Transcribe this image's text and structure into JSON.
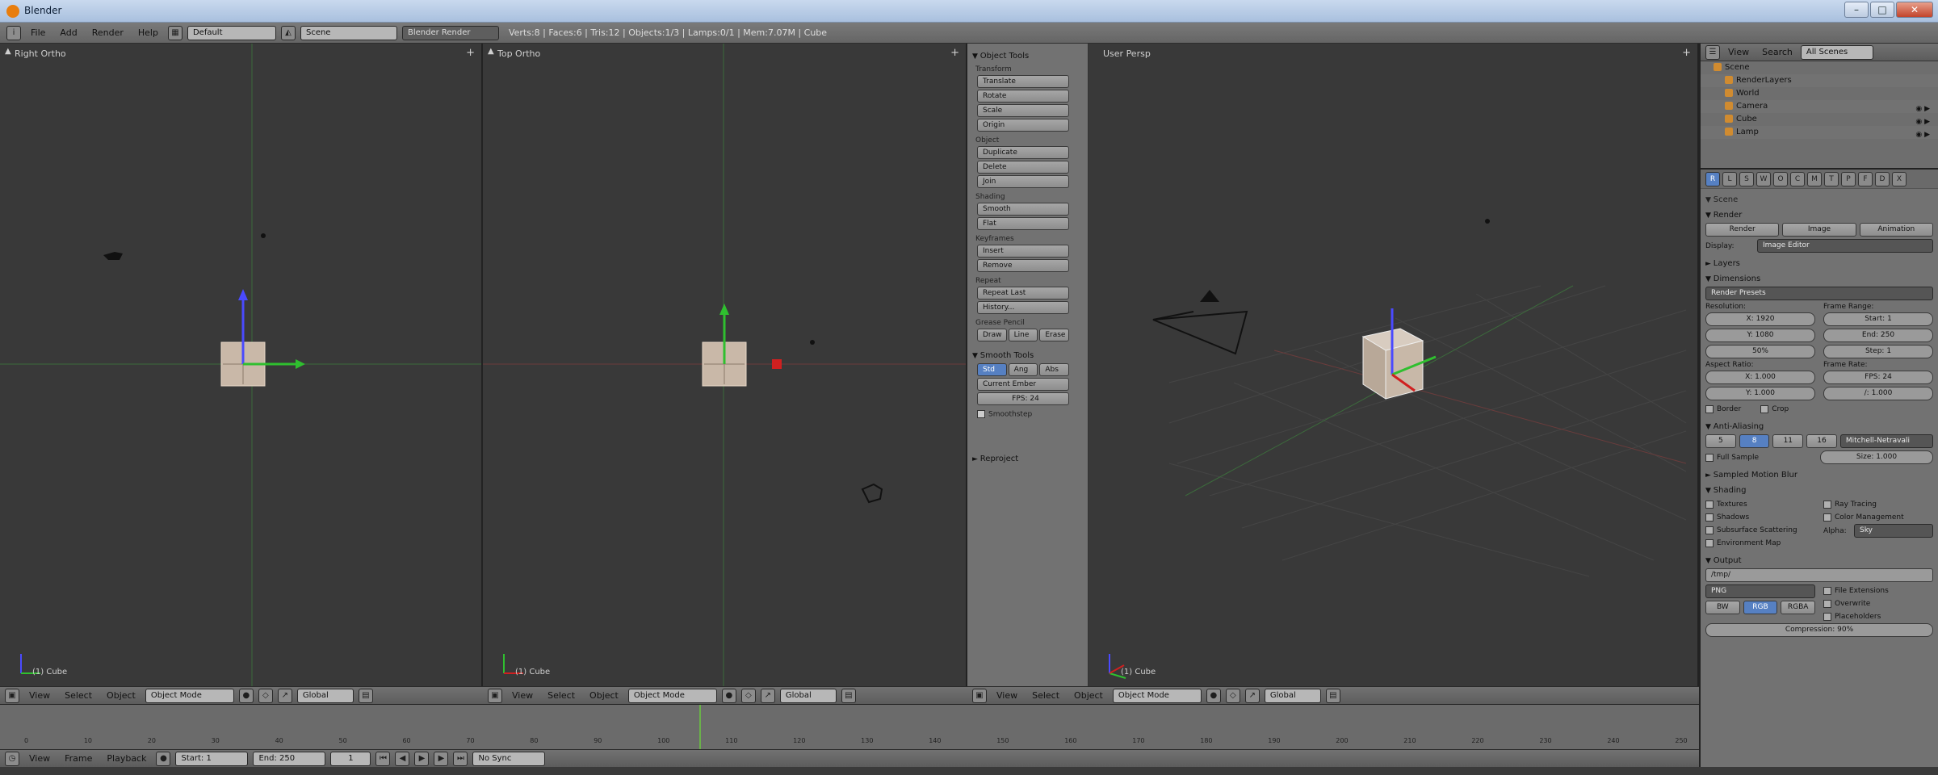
{
  "window": {
    "title": "Blender",
    "min": "–",
    "max": "□",
    "close": "✕"
  },
  "info": {
    "menus": [
      "File",
      "Add",
      "Render",
      "Help"
    ],
    "layout": "Default",
    "scene": "Scene",
    "engine": "Blender Render",
    "stats": "Verts:8 | Faces:6 | Tris:12 | Objects:1/3 | Lamps:0/1 | Mem:7.07M | Cube"
  },
  "viewports": {
    "left": {
      "title": "Right Ortho",
      "footer": "(1) Cube"
    },
    "middle": {
      "title": "Top Ortho",
      "footer": "(1) Cube"
    },
    "right": {
      "title": "User Persp",
      "footer": "(1) Cube"
    }
  },
  "toolshelf": {
    "title": "Object Tools",
    "groups": [
      {
        "label": "Transform",
        "buttons": [
          "Translate",
          "Rotate",
          "Scale",
          "Origin"
        ]
      },
      {
        "label": "Object",
        "buttons": [
          "Duplicate",
          "Delete",
          "Join"
        ]
      },
      {
        "label": "Shading",
        "buttons": [
          "Smooth",
          "Flat"
        ]
      },
      {
        "label": "Keyframes",
        "buttons": [
          "Insert",
          "Remove"
        ]
      },
      {
        "label": "Repeat",
        "buttons": [
          "Repeat Last",
          "History..."
        ]
      }
    ],
    "grease": {
      "label": "Grease Pencil",
      "buttons": [
        "Draw",
        "Line",
        "Erase"
      ]
    },
    "snap": {
      "title": "Smooth Tools",
      "buttons": [
        "Std",
        "Ang",
        "Abs"
      ],
      "field1": "Current Ember",
      "field2": "FPS: 24"
    },
    "smooth_check": "Smoothstep",
    "reproject": "Reproject"
  },
  "vp_header": {
    "menus": [
      "View",
      "Select",
      "Object"
    ],
    "mode": "Object Mode",
    "pivot": "Global"
  },
  "timeline": {
    "menus": [
      "View",
      "Frame",
      "Playback"
    ],
    "start": "Start: 1",
    "end": "End: 250",
    "current": "1",
    "keying": "No Sync",
    "ticks": [
      "0",
      "10",
      "20",
      "30",
      "40",
      "50",
      "60",
      "70",
      "80",
      "90",
      "100",
      "110",
      "120",
      "130",
      "140",
      "150",
      "160",
      "170",
      "180",
      "190",
      "200",
      "210",
      "220",
      "230",
      "240",
      "250"
    ]
  },
  "outliner": {
    "menus": [
      "View",
      "Search"
    ],
    "scene_sel": "All Scenes",
    "rows": [
      "Scene",
      "RenderLayers",
      "World",
      "Camera",
      "Cube",
      "Lamp"
    ]
  },
  "props": {
    "tabs": [
      "R",
      "L",
      "S",
      "W",
      "O",
      "C",
      "M",
      "T",
      "P",
      "F",
      "D",
      "X"
    ],
    "breadcrumb": "Scene",
    "render_title": "Render",
    "render_btns": [
      "Render",
      "Image",
      "Animation"
    ],
    "display_label": "Display:",
    "display_val": "Image Editor",
    "layers_title": "Layers",
    "dimensions_title": "Dimensions",
    "preset": "Render Presets",
    "res_h": "Resolution:",
    "res_x": "X: 1920",
    "res_y": "Y: 1080",
    "res_pct": "50%",
    "frame_h": "Frame Range:",
    "frame_start": "Start: 1",
    "frame_end": "End: 250",
    "frame_step": "Step: 1",
    "aspect_h": "Aspect Ratio:",
    "aspect_x": "X: 1.000",
    "aspect_y": "Y: 1.000",
    "fps_h": "Frame Rate:",
    "fps": "FPS: 24",
    "fps_base": "/: 1.000",
    "border": "Border",
    "crop": "Crop",
    "aa_title": "Anti-Aliasing",
    "aa_vals": [
      "5",
      "8",
      "11",
      "16"
    ],
    "aa_filter": "Mitchell-Netravali",
    "full_sample": "Full Sample",
    "aa_size": "Size: 1.000",
    "motion_title": "Sampled Motion Blur",
    "shading_title": "Shading",
    "shading_checks": [
      "Textures",
      "Shadows",
      "Subsurface Scattering",
      "Environment Map",
      "Ray Tracing",
      "Color Management"
    ],
    "alpha_label": "Alpha:",
    "alpha_val": "Sky",
    "output_title": "Output",
    "output_path": "/tmp/",
    "format_val": "PNG",
    "format_btns": [
      "BW",
      "RGB",
      "RGBA"
    ],
    "overwrite": "File Extensions",
    "placeholders": "Overwrite",
    "placeholders2": "Placeholders",
    "compression": "Compression: 90%"
  }
}
